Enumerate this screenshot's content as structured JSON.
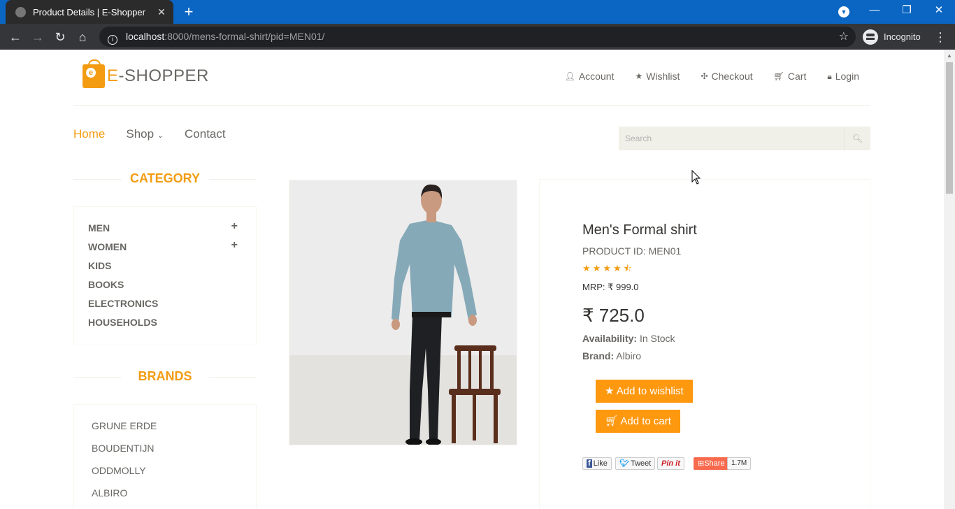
{
  "browser": {
    "tab_title": "Product Details | E-Shopper",
    "url_host": "localhost",
    "url_rest": ":8000/mens-formal-shirt/pid=MEN01/",
    "profile_label": "Incognito"
  },
  "header": {
    "logo_e": "E",
    "logo_rest": "-SHOPPER",
    "links": [
      "Account",
      "Wishlist",
      "Checkout",
      "Cart",
      "Login"
    ]
  },
  "mainnav": {
    "home": "Home",
    "shop": "Shop",
    "contact": "Contact"
  },
  "search": {
    "placeholder": "Search"
  },
  "sidebar": {
    "category_title": "CATEGORY",
    "categories": [
      "MEN",
      "WOMEN",
      "KIDS",
      "BOOKS",
      "ELECTRONICS",
      "HOUSEHOLDS"
    ],
    "brands_title": "BRANDS",
    "brands": [
      "GRUNE ERDE",
      "BOUDENTIJN",
      "ODDMOLLY",
      "ALBIRO"
    ]
  },
  "product": {
    "name": "Men's Formal shirt",
    "id_text": "PRODUCT ID: MEN01",
    "rating": 4.5,
    "mrp": "MRP: ₹ 999.0",
    "price": "₹ 725.0",
    "availability_label": "Availability:",
    "availability_value": "In Stock",
    "brand_label": "Brand:",
    "brand_value": "Albiro",
    "wishlist_button": "Add to wishlist",
    "cart_button": "Add to cart"
  },
  "social": {
    "like": "Like",
    "tweet": "Tweet",
    "pin": "Pin it",
    "share": "Share",
    "count": "1.7M"
  },
  "colors": {
    "accent": "#f39c12",
    "button": "#fe980f",
    "text": "#696763"
  }
}
